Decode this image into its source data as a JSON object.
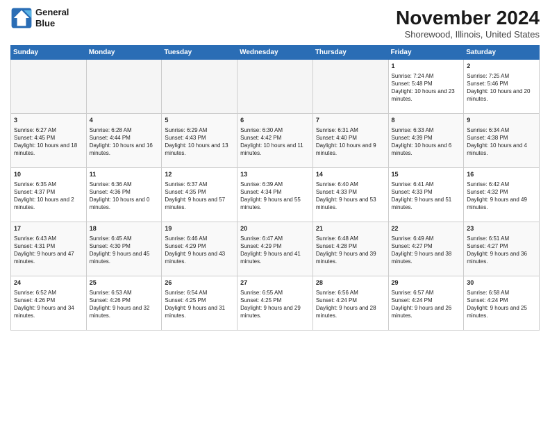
{
  "logo": {
    "line1": "General",
    "line2": "Blue"
  },
  "title": "November 2024",
  "location": "Shorewood, Illinois, United States",
  "weekdays": [
    "Sunday",
    "Monday",
    "Tuesday",
    "Wednesday",
    "Thursday",
    "Friday",
    "Saturday"
  ],
  "weeks": [
    [
      {
        "day": "",
        "empty": true
      },
      {
        "day": "",
        "empty": true
      },
      {
        "day": "",
        "empty": true
      },
      {
        "day": "",
        "empty": true
      },
      {
        "day": "",
        "empty": true
      },
      {
        "day": "1",
        "sunrise": "Sunrise: 7:24 AM",
        "sunset": "Sunset: 5:48 PM",
        "daylight": "Daylight: 10 hours and 23 minutes."
      },
      {
        "day": "2",
        "sunrise": "Sunrise: 7:25 AM",
        "sunset": "Sunset: 5:46 PM",
        "daylight": "Daylight: 10 hours and 20 minutes."
      }
    ],
    [
      {
        "day": "3",
        "sunrise": "Sunrise: 6:27 AM",
        "sunset": "Sunset: 4:45 PM",
        "daylight": "Daylight: 10 hours and 18 minutes."
      },
      {
        "day": "4",
        "sunrise": "Sunrise: 6:28 AM",
        "sunset": "Sunset: 4:44 PM",
        "daylight": "Daylight: 10 hours and 16 minutes."
      },
      {
        "day": "5",
        "sunrise": "Sunrise: 6:29 AM",
        "sunset": "Sunset: 4:43 PM",
        "daylight": "Daylight: 10 hours and 13 minutes."
      },
      {
        "day": "6",
        "sunrise": "Sunrise: 6:30 AM",
        "sunset": "Sunset: 4:42 PM",
        "daylight": "Daylight: 10 hours and 11 minutes."
      },
      {
        "day": "7",
        "sunrise": "Sunrise: 6:31 AM",
        "sunset": "Sunset: 4:40 PM",
        "daylight": "Daylight: 10 hours and 9 minutes."
      },
      {
        "day": "8",
        "sunrise": "Sunrise: 6:33 AM",
        "sunset": "Sunset: 4:39 PM",
        "daylight": "Daylight: 10 hours and 6 minutes."
      },
      {
        "day": "9",
        "sunrise": "Sunrise: 6:34 AM",
        "sunset": "Sunset: 4:38 PM",
        "daylight": "Daylight: 10 hours and 4 minutes."
      }
    ],
    [
      {
        "day": "10",
        "sunrise": "Sunrise: 6:35 AM",
        "sunset": "Sunset: 4:37 PM",
        "daylight": "Daylight: 10 hours and 2 minutes."
      },
      {
        "day": "11",
        "sunrise": "Sunrise: 6:36 AM",
        "sunset": "Sunset: 4:36 PM",
        "daylight": "Daylight: 10 hours and 0 minutes."
      },
      {
        "day": "12",
        "sunrise": "Sunrise: 6:37 AM",
        "sunset": "Sunset: 4:35 PM",
        "daylight": "Daylight: 9 hours and 57 minutes."
      },
      {
        "day": "13",
        "sunrise": "Sunrise: 6:39 AM",
        "sunset": "Sunset: 4:34 PM",
        "daylight": "Daylight: 9 hours and 55 minutes."
      },
      {
        "day": "14",
        "sunrise": "Sunrise: 6:40 AM",
        "sunset": "Sunset: 4:33 PM",
        "daylight": "Daylight: 9 hours and 53 minutes."
      },
      {
        "day": "15",
        "sunrise": "Sunrise: 6:41 AM",
        "sunset": "Sunset: 4:33 PM",
        "daylight": "Daylight: 9 hours and 51 minutes."
      },
      {
        "day": "16",
        "sunrise": "Sunrise: 6:42 AM",
        "sunset": "Sunset: 4:32 PM",
        "daylight": "Daylight: 9 hours and 49 minutes."
      }
    ],
    [
      {
        "day": "17",
        "sunrise": "Sunrise: 6:43 AM",
        "sunset": "Sunset: 4:31 PM",
        "daylight": "Daylight: 9 hours and 47 minutes."
      },
      {
        "day": "18",
        "sunrise": "Sunrise: 6:45 AM",
        "sunset": "Sunset: 4:30 PM",
        "daylight": "Daylight: 9 hours and 45 minutes."
      },
      {
        "day": "19",
        "sunrise": "Sunrise: 6:46 AM",
        "sunset": "Sunset: 4:29 PM",
        "daylight": "Daylight: 9 hours and 43 minutes."
      },
      {
        "day": "20",
        "sunrise": "Sunrise: 6:47 AM",
        "sunset": "Sunset: 4:29 PM",
        "daylight": "Daylight: 9 hours and 41 minutes."
      },
      {
        "day": "21",
        "sunrise": "Sunrise: 6:48 AM",
        "sunset": "Sunset: 4:28 PM",
        "daylight": "Daylight: 9 hours and 39 minutes."
      },
      {
        "day": "22",
        "sunrise": "Sunrise: 6:49 AM",
        "sunset": "Sunset: 4:27 PM",
        "daylight": "Daylight: 9 hours and 38 minutes."
      },
      {
        "day": "23",
        "sunrise": "Sunrise: 6:51 AM",
        "sunset": "Sunset: 4:27 PM",
        "daylight": "Daylight: 9 hours and 36 minutes."
      }
    ],
    [
      {
        "day": "24",
        "sunrise": "Sunrise: 6:52 AM",
        "sunset": "Sunset: 4:26 PM",
        "daylight": "Daylight: 9 hours and 34 minutes."
      },
      {
        "day": "25",
        "sunrise": "Sunrise: 6:53 AM",
        "sunset": "Sunset: 4:26 PM",
        "daylight": "Daylight: 9 hours and 32 minutes."
      },
      {
        "day": "26",
        "sunrise": "Sunrise: 6:54 AM",
        "sunset": "Sunset: 4:25 PM",
        "daylight": "Daylight: 9 hours and 31 minutes."
      },
      {
        "day": "27",
        "sunrise": "Sunrise: 6:55 AM",
        "sunset": "Sunset: 4:25 PM",
        "daylight": "Daylight: 9 hours and 29 minutes."
      },
      {
        "day": "28",
        "sunrise": "Sunrise: 6:56 AM",
        "sunset": "Sunset: 4:24 PM",
        "daylight": "Daylight: 9 hours and 28 minutes."
      },
      {
        "day": "29",
        "sunrise": "Sunrise: 6:57 AM",
        "sunset": "Sunset: 4:24 PM",
        "daylight": "Daylight: 9 hours and 26 minutes."
      },
      {
        "day": "30",
        "sunrise": "Sunrise: 6:58 AM",
        "sunset": "Sunset: 4:24 PM",
        "daylight": "Daylight: 9 hours and 25 minutes."
      }
    ]
  ]
}
